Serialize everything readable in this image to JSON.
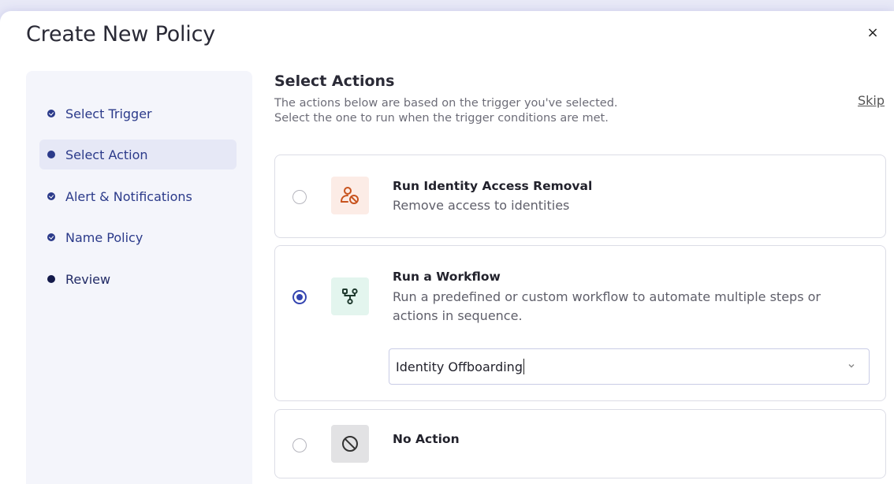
{
  "modal": {
    "title": "Create New Policy",
    "close_label": "×"
  },
  "sidebar": {
    "steps": [
      {
        "label": "Select Trigger",
        "status": "completed"
      },
      {
        "label": "Select Action",
        "status": "current"
      },
      {
        "label": "Alert & Notifications",
        "status": "completed"
      },
      {
        "label": "Name Policy",
        "status": "completed"
      },
      {
        "label": "Review",
        "status": "pending"
      }
    ]
  },
  "main": {
    "title": "Select Actions",
    "description_line1": "The actions below are based on the trigger you've selected.",
    "description_line2": "Select the one to run when the trigger conditions are met.",
    "skip_label": "Skip",
    "actions": [
      {
        "title": "Run Identity Access Removal",
        "description": "Remove access to identities",
        "icon": "user-remove-icon",
        "selected": false,
        "icon_bg": "#fcece6",
        "icon_color": "#c8531e"
      },
      {
        "title": "Run a Workflow",
        "description": "Run a predefined or custom workflow to automate multiple steps or actions in sequence.",
        "icon": "workflow-icon",
        "selected": true,
        "icon_bg": "#e3f5ee",
        "icon_color": "#1f3a2e",
        "dropdown_value": "Identity Offboarding"
      },
      {
        "title": "No Action",
        "description": "",
        "icon": "no-action-icon",
        "selected": false,
        "icon_bg": "#e2e2e4",
        "icon_color": "#333333"
      }
    ]
  },
  "colors": {
    "accent": "#3344b0",
    "step_text": "#2b3a8a",
    "sidebar_bg": "#f4f5fb"
  }
}
